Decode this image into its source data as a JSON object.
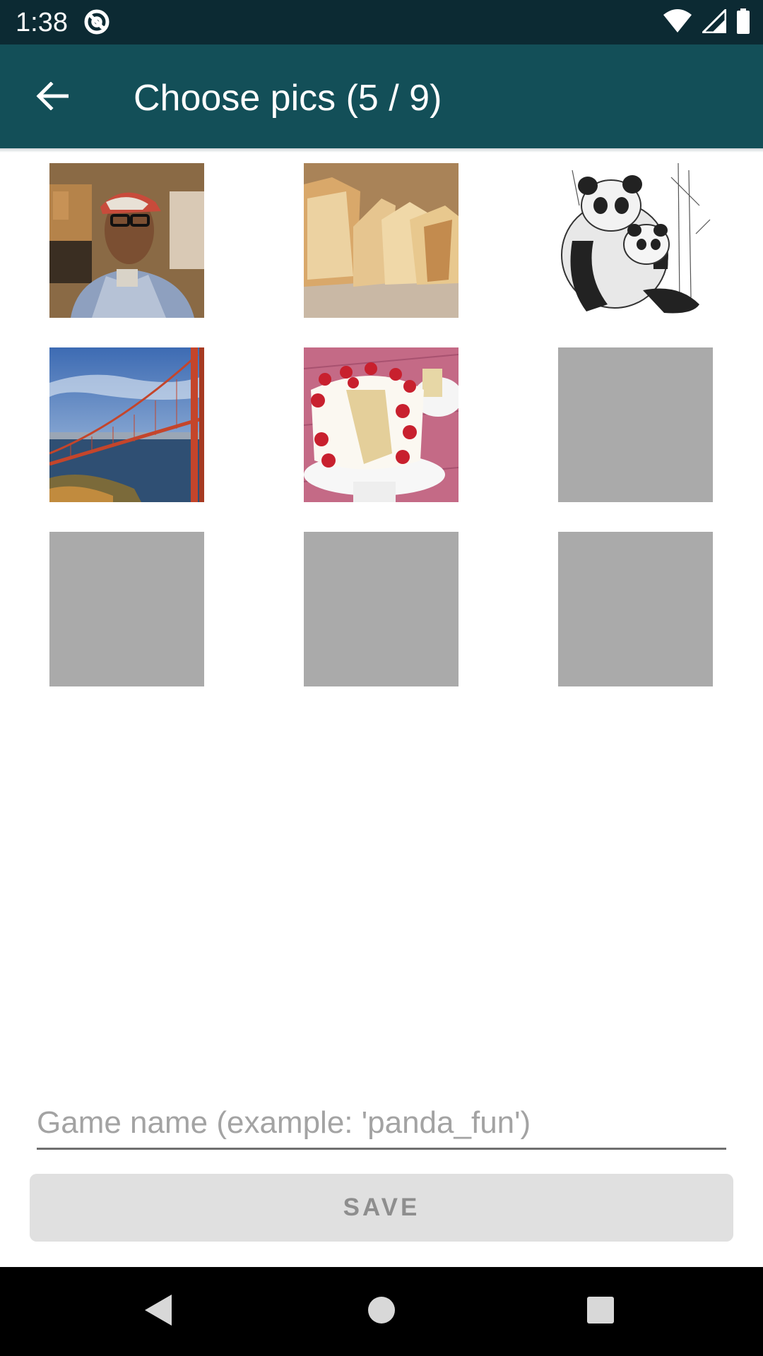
{
  "status_bar": {
    "time": "1:38",
    "icons": [
      "at-sign-icon",
      "wifi-icon",
      "signal-icon",
      "battery-icon"
    ]
  },
  "app_bar": {
    "title": "Choose pics (5 / 9)",
    "back_icon": "arrow-back-icon",
    "background_color": "#134f58"
  },
  "grid": {
    "tiles": [
      {
        "name": "tile-person-photo",
        "filled": true,
        "subject": "person"
      },
      {
        "name": "tile-bread-photo",
        "filled": true,
        "subject": "bread"
      },
      {
        "name": "tile-panda-drawing",
        "filled": true,
        "subject": "panda"
      },
      {
        "name": "tile-bridge-photo",
        "filled": true,
        "subject": "bridge"
      },
      {
        "name": "tile-cake-photo",
        "filled": true,
        "subject": "cake"
      },
      {
        "name": "tile-empty-6",
        "filled": false
      },
      {
        "name": "tile-empty-7",
        "filled": false
      },
      {
        "name": "tile-empty-8",
        "filled": false
      },
      {
        "name": "tile-empty-9",
        "filled": false
      }
    ],
    "empty_color": "#aaaaaa"
  },
  "form": {
    "name_placeholder": "Game name (example: 'panda_fun')",
    "name_value": "",
    "save_label": "SAVE"
  },
  "nav_bar": {
    "icons": [
      "back-triangle-icon",
      "home-circle-icon",
      "recents-square-icon"
    ]
  }
}
